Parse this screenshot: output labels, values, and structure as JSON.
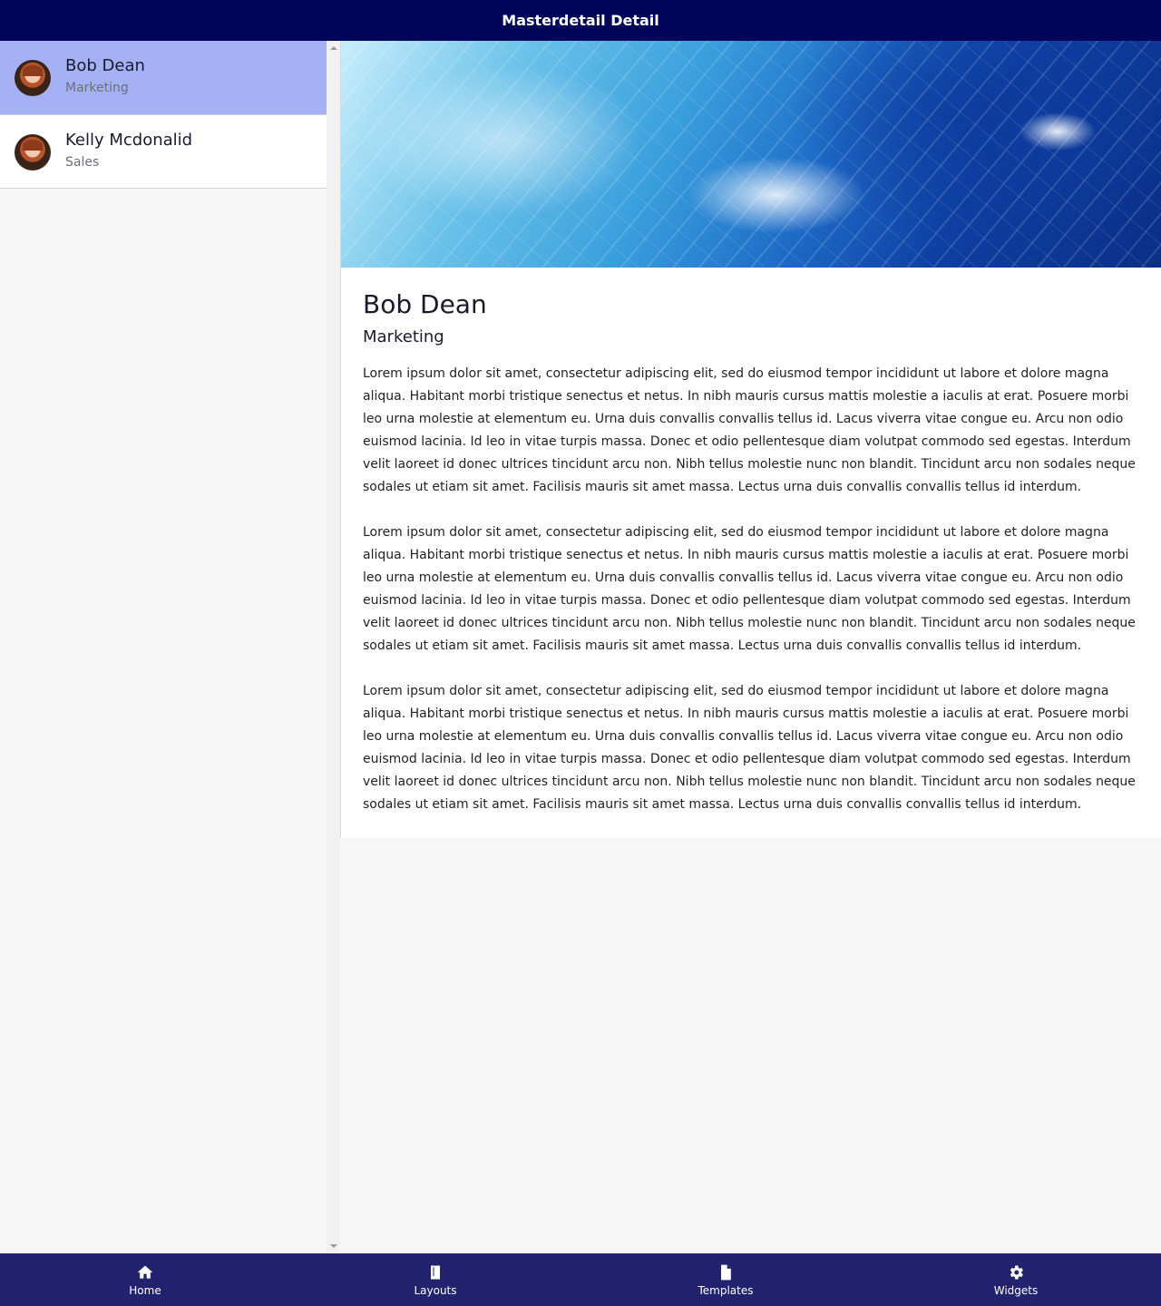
{
  "app": {
    "title": "Masterdetail Detail"
  },
  "list": {
    "items": [
      {
        "name": "Bob Dean",
        "department": "Marketing"
      },
      {
        "name": "Kelly Mcdonalid",
        "department": "Sales"
      }
    ]
  },
  "detail": {
    "name": "Bob Dean",
    "department": "Marketing",
    "paragraphs": [
      "Lorem ipsum dolor sit amet, consectetur adipiscing elit, sed do eiusmod tempor incididunt ut labore et dolore magna aliqua. Habitant morbi tristique senectus et netus. In nibh mauris cursus mattis molestie a iaculis at erat. Posuere morbi leo urna molestie at elementum eu. Urna duis convallis convallis tellus id. Lacus viverra vitae congue eu. Arcu non odio euismod lacinia. Id leo in vitae turpis massa. Donec et odio pellentesque diam volutpat commodo sed egestas. Interdum velit laoreet id donec ultrices tincidunt arcu non. Nibh tellus molestie nunc non blandit. Tincidunt arcu non sodales neque sodales ut etiam sit amet. Facilisis mauris sit amet massa. Lectus urna duis convallis convallis tellus id interdum.",
      "Lorem ipsum dolor sit amet, consectetur adipiscing elit, sed do eiusmod tempor incididunt ut labore et dolore magna aliqua. Habitant morbi tristique senectus et netus. In nibh mauris cursus mattis molestie a iaculis at erat. Posuere morbi leo urna molestie at elementum eu. Urna duis convallis convallis tellus id. Lacus viverra vitae congue eu. Arcu non odio euismod lacinia. Id leo in vitae turpis massa. Donec et odio pellentesque diam volutpat commodo sed egestas. Interdum velit laoreet id donec ultrices tincidunt arcu non. Nibh tellus molestie nunc non blandit. Tincidunt arcu non sodales neque sodales ut etiam sit amet. Facilisis mauris sit amet massa. Lectus urna duis convallis convallis tellus id interdum.",
      "Lorem ipsum dolor sit amet, consectetur adipiscing elit, sed do eiusmod tempor incididunt ut labore et dolore magna aliqua. Habitant morbi tristique senectus et netus. In nibh mauris cursus mattis molestie a iaculis at erat. Posuere morbi leo urna molestie at elementum eu. Urna duis convallis convallis tellus id. Lacus viverra vitae congue eu. Arcu non odio euismod lacinia. Id leo in vitae turpis massa. Donec et odio pellentesque diam volutpat commodo sed egestas. Interdum velit laoreet id donec ultrices tincidunt arcu non. Nibh tellus molestie nunc non blandit. Tincidunt arcu non sodales neque sodales ut etiam sit amet. Facilisis mauris sit amet massa. Lectus urna duis convallis convallis tellus id interdum."
    ]
  },
  "nav": {
    "items": [
      {
        "label": "Home",
        "icon": "home-icon"
      },
      {
        "label": "Layouts",
        "icon": "book-icon"
      },
      {
        "label": "Templates",
        "icon": "file-icon"
      },
      {
        "label": "Widgets",
        "icon": "gear-icon"
      }
    ]
  },
  "colors": {
    "topbar": "#00055a",
    "bottomnav": "#22226e",
    "selected_item": "#a4b2f5"
  }
}
